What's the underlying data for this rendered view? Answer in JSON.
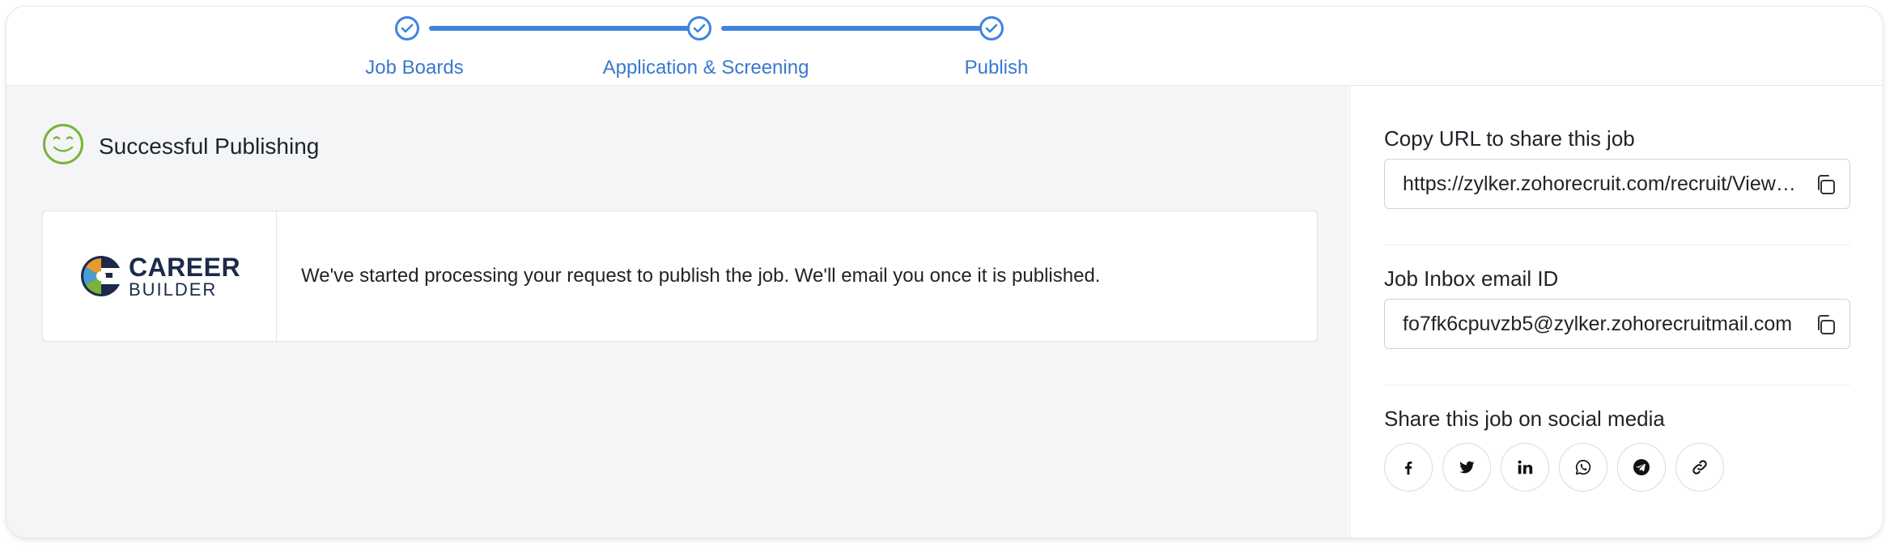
{
  "stepper": {
    "steps": [
      {
        "label": "Job Boards"
      },
      {
        "label": "Application & Screening"
      },
      {
        "label": "Publish"
      }
    ]
  },
  "status": {
    "title": "Successful Publishing",
    "message": "We've started processing your request to publish the job. We'll email you once it is published."
  },
  "job_board": {
    "logo_line1": "CAREER",
    "logo_line2": "BUILDER"
  },
  "share": {
    "url_label": "Copy URL to share this job",
    "url_value": "https://zylker.zohorecruit.com/recruit/ViewJob.na?digest=job",
    "email_label": "Job Inbox email ID",
    "email_value": "fo7fk6cpuvzb5@zylker.zohorecruitmail.com",
    "social_label": "Share this job on social media",
    "social_icons": [
      "facebook-icon",
      "twitter-icon",
      "linkedin-icon",
      "whatsapp-icon",
      "telegram-icon",
      "link-icon"
    ]
  },
  "colors": {
    "accent": "#3f83e0",
    "success": "#7bb33a",
    "logo_navy": "#1c2a4a"
  }
}
